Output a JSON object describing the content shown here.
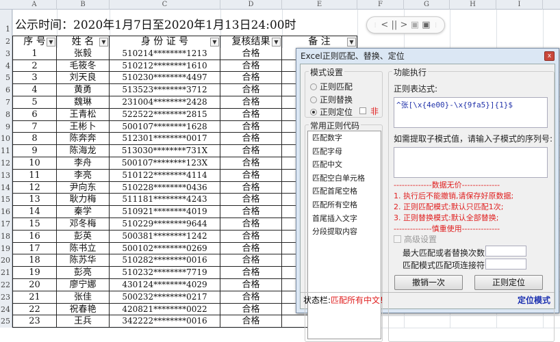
{
  "columns": [
    "A",
    "B",
    "C",
    "D",
    "E",
    "F",
    "G",
    "H",
    "I"
  ],
  "title": "公示时间：2020年1月7日至2020年1月13日24:00时",
  "headers": [
    "序  号",
    "姓  名",
    "身 份 证 号",
    "复核结果",
    "备  注"
  ],
  "rows": [
    [
      "1",
      "张毅",
      "510214********1213",
      "合格"
    ],
    [
      "2",
      "毛筱冬",
      "510212********1610",
      "合格"
    ],
    [
      "3",
      "刘天良",
      "510230********4497",
      "合格"
    ],
    [
      "4",
      "黄勇",
      "513523********3712",
      "合格"
    ],
    [
      "5",
      "魏琳",
      "231004********2428",
      "合格"
    ],
    [
      "6",
      "王青松",
      "522522********2815",
      "合格"
    ],
    [
      "7",
      "王彬卜",
      "500107********1628",
      "合格"
    ],
    [
      "8",
      "陈奔奔",
      "512301********0017",
      "合格"
    ],
    [
      "9",
      "陈海龙",
      "513030********731X",
      "合格"
    ],
    [
      "10",
      "李舟",
      "500107********123X",
      "合格"
    ],
    [
      "11",
      "李亮",
      "510122********4114",
      "合格"
    ],
    [
      "12",
      "尹向东",
      "510228********0436",
      "合格"
    ],
    [
      "13",
      "耿力梅",
      "511181********4243",
      "合格"
    ],
    [
      "14",
      "秦学",
      "510921********4019",
      "合格"
    ],
    [
      "15",
      "邓冬梅",
      "510229********9644",
      "合格"
    ],
    [
      "16",
      "彭英",
      "500381********1242",
      "合格"
    ],
    [
      "17",
      "陈书立",
      "500102********0269",
      "合格"
    ],
    [
      "18",
      "陈苏华",
      "510282********0016",
      "合格"
    ],
    [
      "19",
      "彭亮",
      "510232********7719",
      "合格"
    ],
    [
      "20",
      "廖宁娜",
      "430124********4029",
      "合格"
    ],
    [
      "21",
      "张佳",
      "500232********0217",
      "合格"
    ],
    [
      "22",
      "祝春艳",
      "420821********0022",
      "合格"
    ],
    [
      "23",
      "王兵",
      "342222********0016",
      "合格"
    ]
  ],
  "row_numbers": [
    "1",
    "2",
    "3",
    "4",
    "5",
    "6",
    "7",
    "8",
    "9",
    "10",
    "11",
    "12",
    "13",
    "14",
    "15",
    "16",
    "17",
    "18",
    "19",
    "20",
    "21",
    "22",
    "23",
    "24",
    "25"
  ],
  "dialog": {
    "title": "Excel正则匹配、替换、定位",
    "close": "x",
    "mode_group": "模式设置",
    "modes": [
      "正则匹配",
      "正则替换",
      "正则定位"
    ],
    "not_label": "非",
    "common_group": "常用正则代码",
    "common": [
      "匹配数字",
      "匹配字母",
      "匹配中文",
      "匹配空白单元格",
      "匹配首尾空格",
      "匹配所有空格",
      "首尾插入文字",
      "分段提取内容"
    ],
    "exec_group": "功能执行",
    "regex_label": "正则表达式:",
    "regex_value": "^张[\\x{4e00}-\\x{9fa5}]{1}$",
    "sub_label": "如需提取子模式值，请输入子模式的序列号:",
    "warn": [
      "--------------数据无价--------------",
      "1. 执行后不能撤销,请保存好原数据;",
      "2. 正则匹配模式:默认只匹配1次;",
      "3. 正则替换模式:默认全部替换;",
      "--------------慎重使用--------------"
    ],
    "advanced": "高级设置",
    "max_label": "最大匹配或者替换次数:",
    "join_label": "匹配模式匹配项连接符:",
    "undo": "撤销一次",
    "run": "正则定位",
    "status_label": "状态栏:",
    "status_value": "匹配所有中文!",
    "mode_indicator": "定位模式"
  },
  "colors": {
    "accent_red": "#e02020",
    "mode_blue": "#1a2fb0"
  }
}
